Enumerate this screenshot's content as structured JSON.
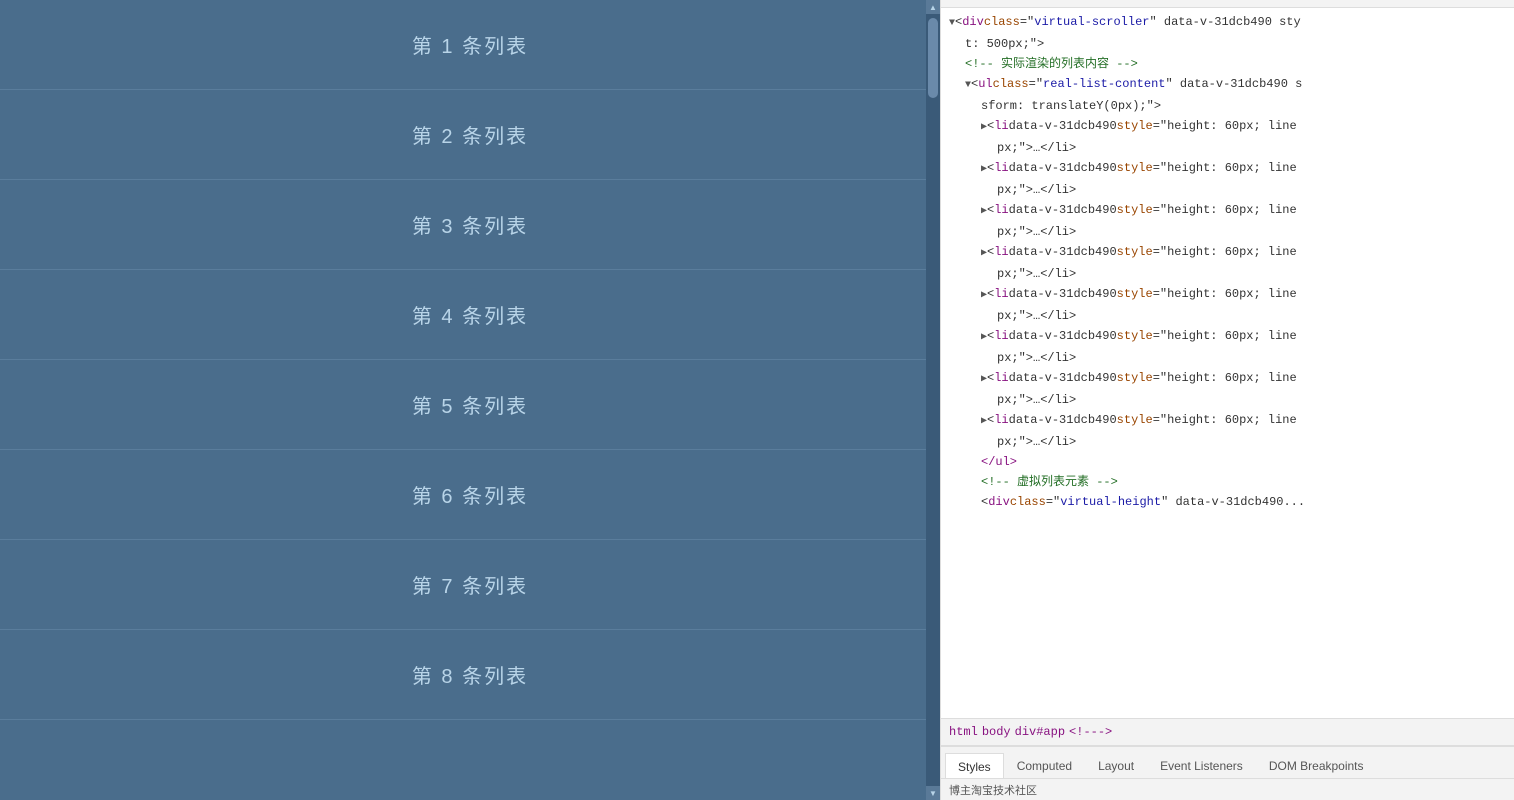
{
  "left_panel": {
    "items": [
      {
        "label": "第 1 条列表"
      },
      {
        "label": "第 2 条列表"
      },
      {
        "label": "第 3 条列表"
      },
      {
        "label": "第 4 条列表"
      },
      {
        "label": "第 5 条列表"
      },
      {
        "label": "第 6 条列表"
      },
      {
        "label": "第 7 条列表"
      },
      {
        "label": "第 8 条列表"
      }
    ]
  },
  "devtools": {
    "breadcrumb": [
      "html",
      "body",
      "div#app",
      "<!--->"
    ],
    "tabs": [
      "Styles",
      "Computed",
      "Layout",
      "Event Listeners",
      "DOM Breakpoints"
    ],
    "active_tab": "Styles",
    "status_bar": "博主淘宝技术社区",
    "code_lines": [
      {
        "indent": 0,
        "content": "▼<div class=\"virtual-scroller\" data-v-31dcb490 sty",
        "type": "tag"
      },
      {
        "indent": 2,
        "content": "t: 500px;\">",
        "type": "plain"
      },
      {
        "indent": 2,
        "content": "<!-- 实际渲染的列表内容 -->",
        "type": "comment"
      },
      {
        "indent": 2,
        "content": "▼<ul class=\"real-list-content\" data-v-31dcb490 s",
        "type": "tag"
      },
      {
        "indent": 4,
        "content": "sform: translateY(0px);\">",
        "type": "plain"
      },
      {
        "indent": 4,
        "content": "▶<li data-v-31dcb490 style=\"height: 60px; line",
        "type": "tag_li"
      },
      {
        "indent": 6,
        "content": "px;\">…</li>",
        "type": "plain"
      },
      {
        "indent": 4,
        "content": "▶<li data-v-31dcb490 style=\"height: 60px; line",
        "type": "tag_li"
      },
      {
        "indent": 6,
        "content": "px;\">…</li>",
        "type": "plain"
      },
      {
        "indent": 4,
        "content": "▶<li data-v-31dcb490 style=\"height: 60px; line",
        "type": "tag_li"
      },
      {
        "indent": 6,
        "content": "px;\">…</li>",
        "type": "plain"
      },
      {
        "indent": 4,
        "content": "▶<li data-v-31dcb490 style=\"height: 60px; line",
        "type": "tag_li"
      },
      {
        "indent": 6,
        "content": "px;\">…</li>",
        "type": "plain"
      },
      {
        "indent": 4,
        "content": "▶<li data-v-31dcb490 style=\"height: 60px; line",
        "type": "tag_li"
      },
      {
        "indent": 6,
        "content": "px;\">…</li>",
        "type": "plain"
      },
      {
        "indent": 4,
        "content": "▶<li data-v-31dcb490 style=\"height: 60px; line",
        "type": "tag_li"
      },
      {
        "indent": 6,
        "content": "px;\">…</li>",
        "type": "plain"
      },
      {
        "indent": 4,
        "content": "▶<li data-v-31dcb490 style=\"height: 60px; line",
        "type": "tag_li"
      },
      {
        "indent": 6,
        "content": "px;\">…</li>",
        "type": "plain"
      },
      {
        "indent": 4,
        "content": "▶<li data-v-31dcb490 style=\"height: 60px; line",
        "type": "tag_li"
      },
      {
        "indent": 6,
        "content": "px;\">…</li>",
        "type": "plain"
      },
      {
        "indent": 4,
        "content": "</ul>",
        "type": "closing_tag"
      },
      {
        "indent": 4,
        "content": "<!-- 虚拟列表元素 -->",
        "type": "comment"
      },
      {
        "indent": 4,
        "content": "<div class=\"virtual-height\" data-v-31dcb490...",
        "type": "tag"
      }
    ]
  }
}
